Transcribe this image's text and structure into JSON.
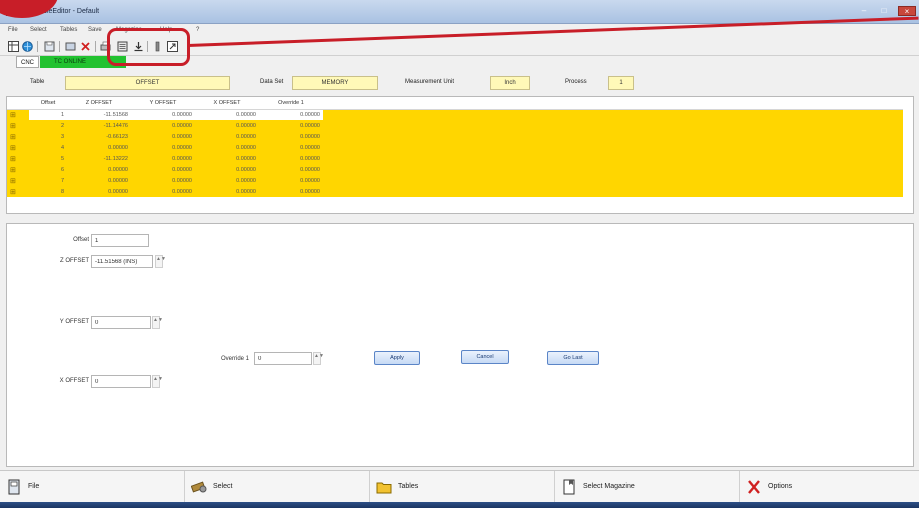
{
  "window": {
    "title": "OVA TableEditor - Default",
    "min_glyph": "–",
    "max_glyph": "□",
    "close_glyph": "×"
  },
  "menu": [
    "File",
    "Select",
    "Tables",
    "Save",
    "Magazine",
    "Help",
    "?"
  ],
  "toolbar": [
    "table-view",
    "globe",
    "save",
    "cut",
    "delete",
    "print",
    "magazine",
    "import",
    "column",
    "export"
  ],
  "status": {
    "cnc_label": "CNC",
    "connection": "TC ONLINE"
  },
  "header": {
    "table_label": "Table",
    "table_value": "OFFSET",
    "dataset_label": "Data Set",
    "dataset_value": "MEMORY",
    "unit_label": "Measurement Unit",
    "unit_value": "Inch",
    "process_label": "Process",
    "process_value": "1"
  },
  "table": {
    "columns": [
      "Offset",
      "Z OFFSET",
      "Y OFFSET",
      "X OFFSET",
      "Override 1"
    ],
    "rows": [
      {
        "marker": "⊞",
        "cells": [
          "1",
          "-11.51568",
          "0.00000",
          "0.00000",
          "0.00000"
        ]
      },
      {
        "marker": "⊞",
        "cells": [
          "2",
          "-11.14476",
          "0.00000",
          "0.00000",
          "0.00000"
        ]
      },
      {
        "marker": "⊞",
        "cells": [
          "3",
          "-0.66123",
          "0.00000",
          "0.00000",
          "0.00000"
        ]
      },
      {
        "marker": "⊞",
        "cells": [
          "4",
          "0.00000",
          "0.00000",
          "0.00000",
          "0.00000"
        ]
      },
      {
        "marker": "⊞",
        "cells": [
          "5",
          "-11.13222",
          "0.00000",
          "0.00000",
          "0.00000"
        ]
      },
      {
        "marker": "⊞",
        "cells": [
          "6",
          "0.00000",
          "0.00000",
          "0.00000",
          "0.00000"
        ]
      },
      {
        "marker": "⊞",
        "cells": [
          "7",
          "0.00000",
          "0.00000",
          "0.00000",
          "0.00000"
        ]
      },
      {
        "marker": "⊞",
        "cells": [
          "8",
          "0.00000",
          "0.00000",
          "0.00000",
          "0.00000"
        ]
      }
    ]
  },
  "edit": {
    "offset_label": "Offset",
    "offset_value": "1",
    "z_label": "Z OFFSET",
    "z_value": "-11.51568 (INS)",
    "y_label": "Y OFFSET",
    "y_value": "0",
    "x_label": "X OFFSET",
    "x_value": "0",
    "override_label": "Override 1",
    "override_value": "0",
    "spin_glyph": "▲▼",
    "apply": "Apply",
    "cancel": "Cancel",
    "golast": "Go Last"
  },
  "nav": [
    {
      "label": "File",
      "icon": "file-icon"
    },
    {
      "label": "Select",
      "icon": "select-icon"
    },
    {
      "label": "Tables",
      "icon": "folder-icon"
    },
    {
      "label": "Select Magazine",
      "icon": "magazine-icon"
    },
    {
      "label": "Options",
      "icon": "options-icon"
    }
  ],
  "colors": {
    "row_highlight": "#ffd600",
    "annotation": "#c81e28",
    "status_green": "#22c230"
  }
}
